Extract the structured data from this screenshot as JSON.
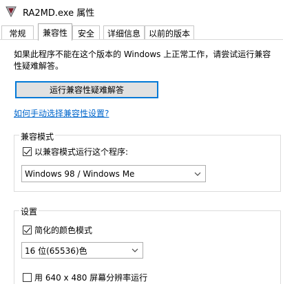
{
  "window": {
    "title": "RA2MD.exe 属性"
  },
  "tabs": [
    {
      "label": "常规"
    },
    {
      "label": "兼容性"
    },
    {
      "label": "安全"
    },
    {
      "label": "详细信息"
    },
    {
      "label": "以前的版本"
    }
  ],
  "intro_text": "如果此程序不能在这个版本的 Windows 上正常工作，请尝试运行兼容性疑难解答。",
  "troubleshoot_button": "运行兼容性疑难解答",
  "manual_link": "如何手动选择兼容性设置?",
  "compat_mode": {
    "group_title": "兼容模式",
    "checkbox_label": "以兼容模式运行这个程序:",
    "checked": true,
    "selected_os": "Windows 98 / Windows Me"
  },
  "settings": {
    "group_title": "设置",
    "reduced_color_label": "简化的颜色模式",
    "reduced_color_checked": true,
    "color_value": "16 位(65536)色",
    "resolution_label": "用 640 x 480 屏幕分辨率运行",
    "resolution_checked": false
  },
  "icons": {
    "app": "ra2-app-icon",
    "dropdown": "chevron-down-icon"
  }
}
